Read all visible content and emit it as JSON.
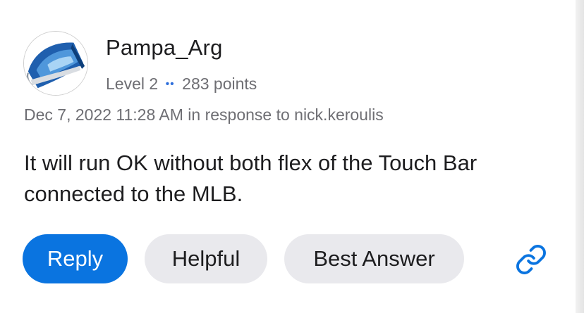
{
  "post": {
    "avatar_icon": "imac-avatar-icon",
    "author": "Pampa_Arg",
    "level": "Level 2",
    "separator": "••",
    "points": "283 points",
    "timestamp_line": "Dec 7, 2022 11:28 AM in response to nick.keroulis",
    "body": "It will run OK without both flex of the Touch Bar connected to the MLB."
  },
  "actions": {
    "reply_label": "Reply",
    "helpful_label": "Helpful",
    "best_answer_label": "Best Answer",
    "link_icon": "link-icon"
  },
  "colors": {
    "accent": "#0a74e0",
    "secondary_button": "#e9e9ed",
    "muted_text": "#6e6e73",
    "separator_dots": "#2f6fdb"
  }
}
